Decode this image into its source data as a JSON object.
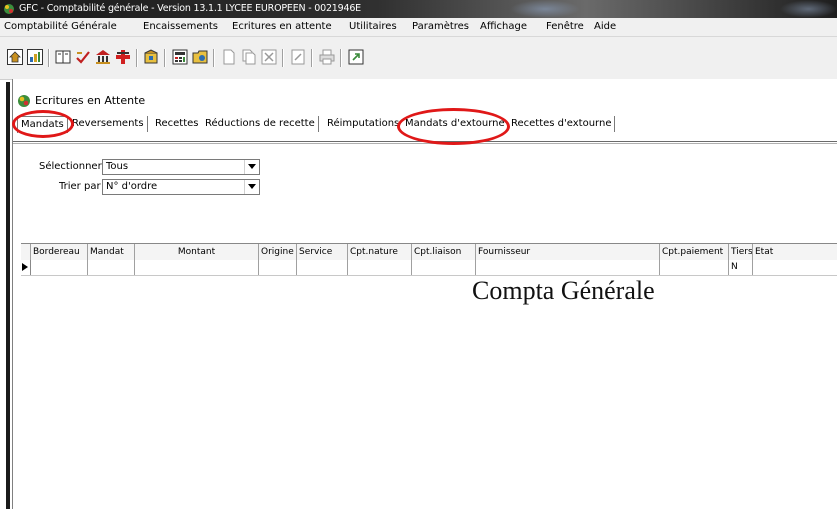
{
  "window": {
    "title": "GFC - Comptabilité générale - Version 13.1.1   LYCEE EUROPEEN - 0021946E"
  },
  "menu": {
    "items": [
      "Comptabilité Générale",
      "Encaissements",
      "Ecritures en attente",
      "Utilitaires",
      "Paramètres",
      "Affichage",
      "Fenêtre",
      "Aide"
    ]
  },
  "toolbar": {
    "icons": [
      "home-icon",
      "chart-icon",
      "ledger-icon",
      "check-icon",
      "bank-icon",
      "cross-icon",
      "package-icon",
      "calculator-icon",
      "folder-icon",
      "new-document-icon",
      "copy-document-icon",
      "delete-icon",
      "edit-icon",
      "print-icon",
      "export-icon"
    ]
  },
  "child_window": {
    "title": "Ecritures en Attente",
    "tabs": [
      "Mandats",
      "Reversements",
      "Recettes",
      "Réductions de recette",
      "Réimputations",
      "Mandats d'extourne",
      "Recettes d'extourne"
    ],
    "active_tab": "Mandats"
  },
  "filters": {
    "select_label": "Sélectionner",
    "select_value": "Tous",
    "sort_label": "Trier par",
    "sort_value": "N° d'ordre"
  },
  "grid": {
    "columns": [
      "Bordereau",
      "Mandat",
      "Montant",
      "Origine",
      "Service",
      "Cpt.nature",
      "Cpt.liaison",
      "Fournisseur",
      "Cpt.paiement",
      "Tiers",
      "Etat"
    ],
    "rows": [
      [
        "",
        "",
        "",
        "",
        "",
        "",
        "",
        "",
        "",
        "N",
        ""
      ]
    ]
  },
  "overlay": {
    "caption": "Compta Générale"
  },
  "colors": {
    "annotation_red": "#e01818",
    "titlebar": "#1a1a1a",
    "menubar": "#f0f0f0"
  }
}
